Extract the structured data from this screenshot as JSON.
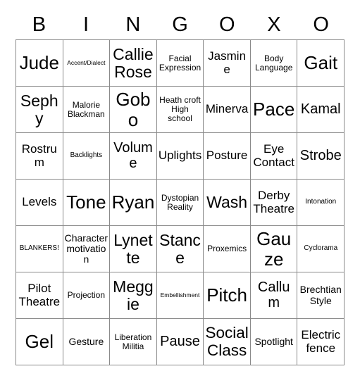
{
  "card": {
    "header_letters": [
      "B",
      "I",
      "N",
      "G",
      "O",
      "X",
      "O"
    ],
    "rows": [
      [
        {
          "text": "Jude",
          "size": "fs-xxl"
        },
        {
          "text": "Accent/Dialect",
          "size": "fs-tiny"
        },
        {
          "text": "Callie Rose",
          "size": "fs-xl"
        },
        {
          "text": "Facial Expression",
          "size": "fs-xs"
        },
        {
          "text": "Jasmine",
          "size": "fs-md"
        },
        {
          "text": "Body Language",
          "size": "fs-xs"
        },
        {
          "text": "Gait",
          "size": "fs-xxl"
        }
      ],
      [
        {
          "text": "Sephy",
          "size": "fs-xl"
        },
        {
          "text": "Malorie Blackman",
          "size": "fs-xs"
        },
        {
          "text": "Gobo",
          "size": "fs-xxl"
        },
        {
          "text": "Heath croft High school",
          "size": "fs-xs"
        },
        {
          "text": "Minerva",
          "size": "fs-md"
        },
        {
          "text": "Pace",
          "size": "fs-xxl"
        },
        {
          "text": "Kamal",
          "size": "fs-lg"
        }
      ],
      [
        {
          "text": "Rostrum",
          "size": "fs-md"
        },
        {
          "text": "Backlights",
          "size": "fs-xxs"
        },
        {
          "text": "Volume",
          "size": "fs-lg"
        },
        {
          "text": "Uplights",
          "size": "fs-md"
        },
        {
          "text": "Posture",
          "size": "fs-md"
        },
        {
          "text": "Eye Contact",
          "size": "fs-md"
        },
        {
          "text": "Strobe",
          "size": "fs-lg"
        }
      ],
      [
        {
          "text": "Levels",
          "size": "fs-md"
        },
        {
          "text": "Tone",
          "size": "fs-xxl"
        },
        {
          "text": "Ryan",
          "size": "fs-xxl"
        },
        {
          "text": "Dystopian Reality",
          "size": "fs-xs"
        },
        {
          "text": "Wash",
          "size": "fs-xl"
        },
        {
          "text": "Derby Theatre",
          "size": "fs-md"
        },
        {
          "text": "Intonation",
          "size": "fs-xxs"
        }
      ],
      [
        {
          "text": "BLANKERS!",
          "size": "fs-xxs"
        },
        {
          "text": "Character motivation",
          "size": "fs-sm"
        },
        {
          "text": "Lynette",
          "size": "fs-xl"
        },
        {
          "text": "Stance",
          "size": "fs-xl"
        },
        {
          "text": "Proxemics",
          "size": "fs-xs"
        },
        {
          "text": "Gauze",
          "size": "fs-xxl"
        },
        {
          "text": "Cyclorama",
          "size": "fs-xxs"
        }
      ],
      [
        {
          "text": "Pilot Theatre",
          "size": "fs-md"
        },
        {
          "text": "Projection",
          "size": "fs-xs"
        },
        {
          "text": "Meggie",
          "size": "fs-xl"
        },
        {
          "text": "Embellishment",
          "size": "fs-tiny"
        },
        {
          "text": "Pitch",
          "size": "fs-xxl"
        },
        {
          "text": "Callum",
          "size": "fs-lg"
        },
        {
          "text": "Brechtian Style",
          "size": "fs-sm"
        }
      ],
      [
        {
          "text": "Gel",
          "size": "fs-xxl"
        },
        {
          "text": "Gesture",
          "size": "fs-sm"
        },
        {
          "text": "Liberation Militia",
          "size": "fs-xs"
        },
        {
          "text": "Pause",
          "size": "fs-lg"
        },
        {
          "text": "Social Class",
          "size": "fs-xl"
        },
        {
          "text": "Spotlight",
          "size": "fs-sm"
        },
        {
          "text": "Electric fence",
          "size": "fs-md"
        }
      ]
    ]
  },
  "colors": {
    "background": "#ffffff",
    "grid_border": "#8a8a8a",
    "text": "#000000"
  }
}
